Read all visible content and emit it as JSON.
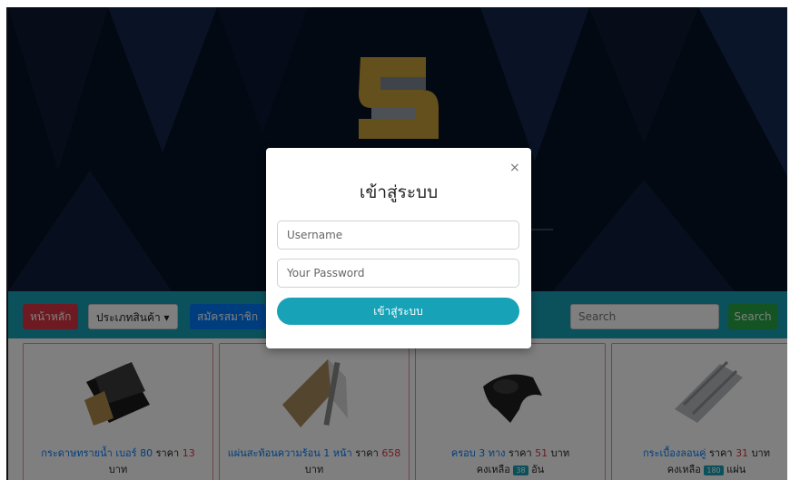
{
  "navbar": {
    "home_label": "หน้าหลัก",
    "category_label": "ประเภทสินค้า ▾",
    "register_label": "สมัครสมาชิก",
    "search_placeholder": "Search",
    "search_button": "Search"
  },
  "products": [
    {
      "name": "กระดาษทรายน้ำ เบอร์ 80",
      "price_label": "ราคา",
      "price": "13",
      "unit": "บาท",
      "stock_label": "",
      "stock": "",
      "stock_unit": ""
    },
    {
      "name": "แผ่นสะท้อนความร้อน 1 หน้า",
      "price_label": "ราคา",
      "price": "658",
      "unit": "บาท",
      "stock_label": "",
      "stock": "",
      "stock_unit": ""
    },
    {
      "name": "ครอบ 3 ทาง",
      "price_label": "ราคา",
      "price": "51",
      "unit": "บาท",
      "stock_label": "คงเหลือ",
      "stock": "38",
      "stock_unit": "อัน"
    },
    {
      "name": "กระเบื้องลอนคู่",
      "price_label": "ราคา",
      "price": "31",
      "unit": "บาท",
      "stock_label": "คงเหลือ",
      "stock": "180",
      "stock_unit": "แผ่น"
    }
  ],
  "modal": {
    "close_symbol": "×",
    "title": "เข้าสู่ระบบ",
    "username_placeholder": "Username",
    "password_placeholder": "Your Password",
    "submit_label": "เข้าสู่ระบบ"
  }
}
